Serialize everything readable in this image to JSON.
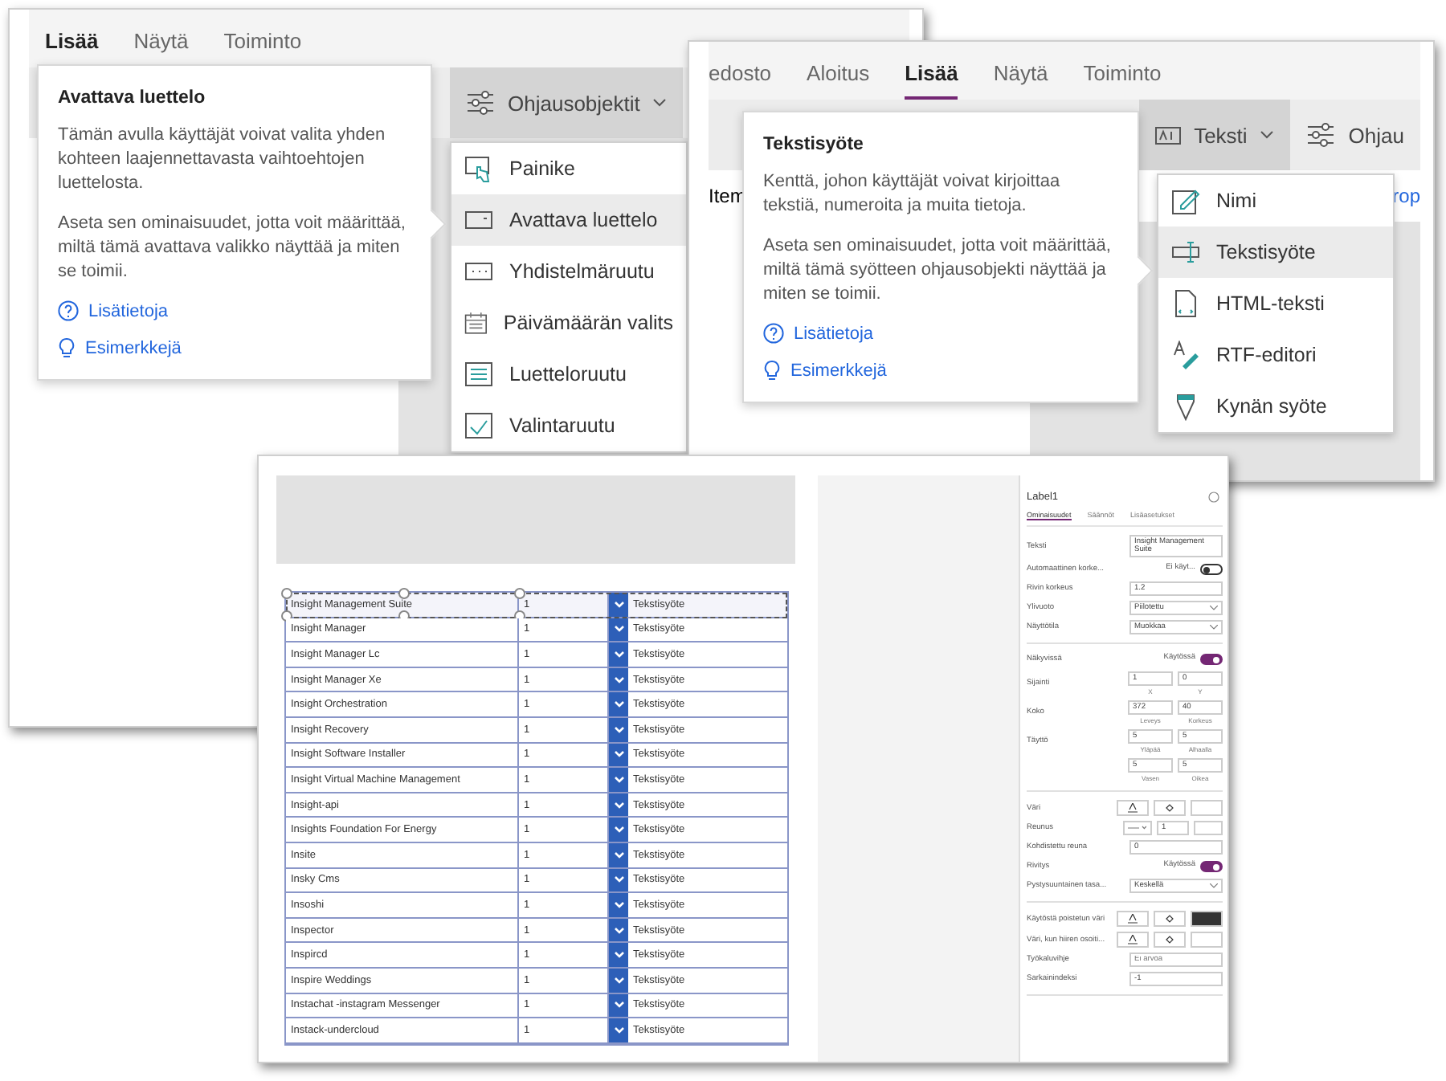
{
  "window_insert": {
    "tabs": [
      {
        "label": "Lisää",
        "selected": true
      },
      {
        "label": "Näytä",
        "selected": false
      },
      {
        "label": "Toiminto",
        "selected": false
      }
    ],
    "controls_button": {
      "label": "Ohjausobjektit"
    },
    "menu": [
      {
        "kind": "button",
        "label": "Painike",
        "selected": false
      },
      {
        "kind": "dropdown",
        "label": "Avattava luettelo",
        "selected": true
      },
      {
        "kind": "combo",
        "label": "Yhdistelmäruutu",
        "selected": false
      },
      {
        "kind": "date",
        "label": "Päivämäärän valits",
        "selected": false
      },
      {
        "kind": "list",
        "label": "Luetteloruutu",
        "selected": false
      },
      {
        "kind": "check",
        "label": "Valintaruutu",
        "selected": false
      }
    ],
    "tooltip": {
      "title": "Avattava luettelo",
      "paragraphs": [
        "Tämän avulla käyttäjät voivat valita yhden kohteen laajennettavasta vaihtoehtojen luettelosta.",
        "Aseta sen ominaisuudet, jotta voit määrittää, miltä tämä avattava valikko näyttää ja miten se toimii."
      ],
      "links": [
        {
          "kind": "help",
          "label": "Lisätietoja"
        },
        {
          "kind": "idea",
          "label": "Esimerkkejä"
        }
      ]
    }
  },
  "window_text": {
    "tabs": [
      {
        "label": "edosto",
        "selected": false
      },
      {
        "label": "Aloitus",
        "selected": false
      },
      {
        "label": "Lisää",
        "selected": true
      },
      {
        "label": "Näytä",
        "selected": false
      },
      {
        "label": "Toiminto",
        "selected": false
      }
    ],
    "text_button": {
      "label": "Teksti"
    },
    "controls_button": {
      "label": "Ohjau"
    },
    "formula": {
      "property": "Item",
      "link": "rop"
    },
    "menu": [
      {
        "kind": "label",
        "label": "Nimi",
        "selected": false
      },
      {
        "kind": "input",
        "label": "Tekstisyöte",
        "selected": true
      },
      {
        "kind": "html",
        "label": "HTML-teksti",
        "selected": false
      },
      {
        "kind": "rtf",
        "label": "RTF-editori",
        "selected": false
      },
      {
        "kind": "pen",
        "label": "Kynän syöte",
        "selected": false
      }
    ],
    "tooltip": {
      "title": "Tekstisyöte",
      "paragraphs": [
        "Kenttä, johon käyttäjät voivat kirjoittaa tekstiä, numeroita ja muita tietoja.",
        "Aseta sen ominaisuudet, jotta voit määrittää, miltä tämä syötteen ohjausobjekti näyttää ja miten se toimii."
      ],
      "links": [
        {
          "kind": "help",
          "label": "Lisätietoja"
        },
        {
          "kind": "idea",
          "label": "Esimerkkejä"
        }
      ]
    }
  },
  "window_editor": {
    "table": {
      "rows": [
        {
          "name": "Insight Management Suite",
          "value": "1",
          "type": "Tekstisyöte",
          "selected": true
        },
        {
          "name": "Insight Manager",
          "value": "1",
          "type": "Tekstisyöte",
          "selected": false
        },
        {
          "name": "Insight Manager Lc",
          "value": "1",
          "type": "Tekstisyöte",
          "selected": false
        },
        {
          "name": "Insight Manager Xe",
          "value": "1",
          "type": "Tekstisyöte",
          "selected": false
        },
        {
          "name": "Insight Orchestration",
          "value": "1",
          "type": "Tekstisyöte",
          "selected": false
        },
        {
          "name": "Insight Recovery",
          "value": "1",
          "type": "Tekstisyöte",
          "selected": false
        },
        {
          "name": "Insight Software Installer",
          "value": "1",
          "type": "Tekstisyöte",
          "selected": false
        },
        {
          "name": "Insight Virtual Machine Management",
          "value": "1",
          "type": "Tekstisyöte",
          "selected": false
        },
        {
          "name": "Insight-api",
          "value": "1",
          "type": "Tekstisyöte",
          "selected": false
        },
        {
          "name": "Insights Foundation For Energy",
          "value": "1",
          "type": "Tekstisyöte",
          "selected": false
        },
        {
          "name": "Insite",
          "value": "1",
          "type": "Tekstisyöte",
          "selected": false
        },
        {
          "name": "Insky Cms",
          "value": "1",
          "type": "Tekstisyöte",
          "selected": false
        },
        {
          "name": "Insoshi",
          "value": "1",
          "type": "Tekstisyöte",
          "selected": false
        },
        {
          "name": "Inspector",
          "value": "1",
          "type": "Tekstisyöte",
          "selected": false
        },
        {
          "name": "Inspircd",
          "value": "1",
          "type": "Tekstisyöte",
          "selected": false
        },
        {
          "name": "Inspire Weddings",
          "value": "1",
          "type": "Tekstisyöte",
          "selected": false
        },
        {
          "name": "Instachat -instagram Messenger",
          "value": "1",
          "type": "Tekstisyöte",
          "selected": false
        },
        {
          "name": "Instack-undercloud",
          "value": "1",
          "type": "Tekstisyöte",
          "selected": false
        }
      ]
    },
    "properties": {
      "name": "Label1",
      "tabs": [
        {
          "label": "Ominaisuudet",
          "selected": true
        },
        {
          "label": "Säännöt",
          "selected": false
        },
        {
          "label": "Lisäasetukset",
          "selected": false
        }
      ],
      "sections": [
        [
          {
            "kind": "value",
            "label": "Teksti",
            "value": "Insight Management Suite"
          },
          {
            "kind": "toggle",
            "label": "Automaattinen korke...",
            "value": "Ei käyt...",
            "on": false
          },
          {
            "kind": "value",
            "label": "Rivin korkeus",
            "value": "1.2"
          },
          {
            "kind": "select",
            "label": "Ylivuoto",
            "value": "Piilotettu"
          },
          {
            "kind": "select",
            "label": "Näyttötila",
            "value": "Muokkaa"
          }
        ],
        [
          {
            "kind": "toggle",
            "label": "Näkyvissä",
            "value": "Käytössä",
            "on": true
          },
          {
            "kind": "pair",
            "label": "Sijainti",
            "fields": [
              {
                "value": "1",
                "caption": "X"
              },
              {
                "value": "0",
                "caption": "Y"
              }
            ]
          },
          {
            "kind": "pair",
            "label": "Koko",
            "fields": [
              {
                "value": "372",
                "caption": "Leveys"
              },
              {
                "value": "40",
                "caption": "Korkeus"
              }
            ]
          },
          {
            "kind": "pair",
            "label": "Täyttö",
            "fields": [
              {
                "value": "5",
                "caption": "Yläpää"
              },
              {
                "value": "5",
                "caption": "Alhaalla"
              }
            ]
          },
          {
            "kind": "pair",
            "fields": [
              {
                "value": "5",
                "caption": "Vasen"
              },
              {
                "value": "5",
                "caption": "Oikea"
              }
            ]
          }
        ],
        [
          {
            "kind": "color",
            "label": "Väri",
            "filled": false
          },
          {
            "kind": "border",
            "label": "Reunus",
            "value": "1"
          },
          {
            "kind": "value",
            "label": "Kohdistettu reuna",
            "value": "0"
          },
          {
            "kind": "toggle",
            "label": "Rivitys",
            "value": "Käytössä",
            "on": true
          },
          {
            "kind": "select",
            "label": "Pystysuuntainen tasa...",
            "value": "Keskellä"
          }
        ],
        [
          {
            "kind": "color",
            "label": "Käytöstä poistetun väri",
            "filled": true
          },
          {
            "kind": "color",
            "label": "Väri, kun hiiren osoiti...",
            "filled": false
          },
          {
            "kind": "input",
            "label": "Työkaluvihje",
            "placeholder": "Ei arvoa"
          },
          {
            "kind": "value",
            "label": "Sarkainindeksi",
            "value": "-1"
          }
        ]
      ]
    }
  }
}
